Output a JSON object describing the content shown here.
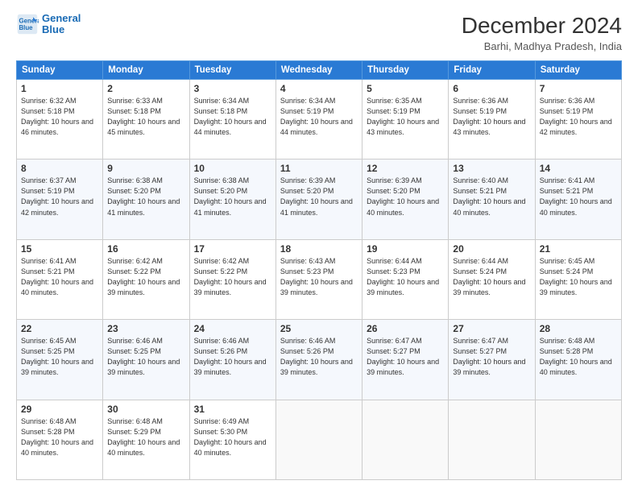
{
  "logo": {
    "line1": "General",
    "line2": "Blue"
  },
  "title": "December 2024",
  "subtitle": "Barhi, Madhya Pradesh, India",
  "days_header": [
    "Sunday",
    "Monday",
    "Tuesday",
    "Wednesday",
    "Thursday",
    "Friday",
    "Saturday"
  ],
  "weeks": [
    [
      {
        "day": "1",
        "sunrise": "6:32 AM",
        "sunset": "5:18 PM",
        "daylight": "10 hours and 46 minutes."
      },
      {
        "day": "2",
        "sunrise": "6:33 AM",
        "sunset": "5:18 PM",
        "daylight": "10 hours and 45 minutes."
      },
      {
        "day": "3",
        "sunrise": "6:34 AM",
        "sunset": "5:18 PM",
        "daylight": "10 hours and 44 minutes."
      },
      {
        "day": "4",
        "sunrise": "6:34 AM",
        "sunset": "5:19 PM",
        "daylight": "10 hours and 44 minutes."
      },
      {
        "day": "5",
        "sunrise": "6:35 AM",
        "sunset": "5:19 PM",
        "daylight": "10 hours and 43 minutes."
      },
      {
        "day": "6",
        "sunrise": "6:36 AM",
        "sunset": "5:19 PM",
        "daylight": "10 hours and 43 minutes."
      },
      {
        "day": "7",
        "sunrise": "6:36 AM",
        "sunset": "5:19 PM",
        "daylight": "10 hours and 42 minutes."
      }
    ],
    [
      {
        "day": "8",
        "sunrise": "6:37 AM",
        "sunset": "5:19 PM",
        "daylight": "10 hours and 42 minutes."
      },
      {
        "day": "9",
        "sunrise": "6:38 AM",
        "sunset": "5:20 PM",
        "daylight": "10 hours and 41 minutes."
      },
      {
        "day": "10",
        "sunrise": "6:38 AM",
        "sunset": "5:20 PM",
        "daylight": "10 hours and 41 minutes."
      },
      {
        "day": "11",
        "sunrise": "6:39 AM",
        "sunset": "5:20 PM",
        "daylight": "10 hours and 41 minutes."
      },
      {
        "day": "12",
        "sunrise": "6:39 AM",
        "sunset": "5:20 PM",
        "daylight": "10 hours and 40 minutes."
      },
      {
        "day": "13",
        "sunrise": "6:40 AM",
        "sunset": "5:21 PM",
        "daylight": "10 hours and 40 minutes."
      },
      {
        "day": "14",
        "sunrise": "6:41 AM",
        "sunset": "5:21 PM",
        "daylight": "10 hours and 40 minutes."
      }
    ],
    [
      {
        "day": "15",
        "sunrise": "6:41 AM",
        "sunset": "5:21 PM",
        "daylight": "10 hours and 40 minutes."
      },
      {
        "day": "16",
        "sunrise": "6:42 AM",
        "sunset": "5:22 PM",
        "daylight": "10 hours and 39 minutes."
      },
      {
        "day": "17",
        "sunrise": "6:42 AM",
        "sunset": "5:22 PM",
        "daylight": "10 hours and 39 minutes."
      },
      {
        "day": "18",
        "sunrise": "6:43 AM",
        "sunset": "5:23 PM",
        "daylight": "10 hours and 39 minutes."
      },
      {
        "day": "19",
        "sunrise": "6:44 AM",
        "sunset": "5:23 PM",
        "daylight": "10 hours and 39 minutes."
      },
      {
        "day": "20",
        "sunrise": "6:44 AM",
        "sunset": "5:24 PM",
        "daylight": "10 hours and 39 minutes."
      },
      {
        "day": "21",
        "sunrise": "6:45 AM",
        "sunset": "5:24 PM",
        "daylight": "10 hours and 39 minutes."
      }
    ],
    [
      {
        "day": "22",
        "sunrise": "6:45 AM",
        "sunset": "5:25 PM",
        "daylight": "10 hours and 39 minutes."
      },
      {
        "day": "23",
        "sunrise": "6:46 AM",
        "sunset": "5:25 PM",
        "daylight": "10 hours and 39 minutes."
      },
      {
        "day": "24",
        "sunrise": "6:46 AM",
        "sunset": "5:26 PM",
        "daylight": "10 hours and 39 minutes."
      },
      {
        "day": "25",
        "sunrise": "6:46 AM",
        "sunset": "5:26 PM",
        "daylight": "10 hours and 39 minutes."
      },
      {
        "day": "26",
        "sunrise": "6:47 AM",
        "sunset": "5:27 PM",
        "daylight": "10 hours and 39 minutes."
      },
      {
        "day": "27",
        "sunrise": "6:47 AM",
        "sunset": "5:27 PM",
        "daylight": "10 hours and 39 minutes."
      },
      {
        "day": "28",
        "sunrise": "6:48 AM",
        "sunset": "5:28 PM",
        "daylight": "10 hours and 40 minutes."
      }
    ],
    [
      {
        "day": "29",
        "sunrise": "6:48 AM",
        "sunset": "5:28 PM",
        "daylight": "10 hours and 40 minutes."
      },
      {
        "day": "30",
        "sunrise": "6:48 AM",
        "sunset": "5:29 PM",
        "daylight": "10 hours and 40 minutes."
      },
      {
        "day": "31",
        "sunrise": "6:49 AM",
        "sunset": "5:30 PM",
        "daylight": "10 hours and 40 minutes."
      },
      null,
      null,
      null,
      null
    ]
  ]
}
